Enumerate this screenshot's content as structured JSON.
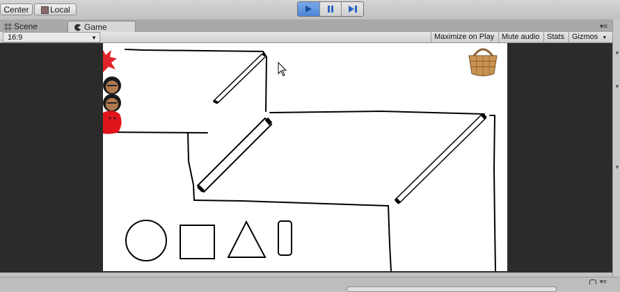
{
  "toolbar": {
    "pivot_label": "Center",
    "space_label": "Local",
    "play_icon": "play-icon",
    "pause_icon": "pause-icon",
    "step_icon": "step-icon",
    "play_active": true,
    "accent": "#4d86d8"
  },
  "tabs": [
    {
      "label": "Scene",
      "icon": "grid-icon"
    },
    {
      "label": "Game",
      "icon": "pacman-icon"
    }
  ],
  "game_bar": {
    "aspect": "16:9",
    "maximize_label": "Maximize on Play",
    "mute_label": "Mute audio",
    "stats_label": "Stats",
    "gizmos_label": "Gizmos"
  },
  "scene": {
    "sprites": [
      "red-flower",
      "character-head",
      "character-head",
      "red-character",
      "basket"
    ],
    "shapes": [
      "circle",
      "square",
      "triangle",
      "rounded-rectangle"
    ]
  }
}
